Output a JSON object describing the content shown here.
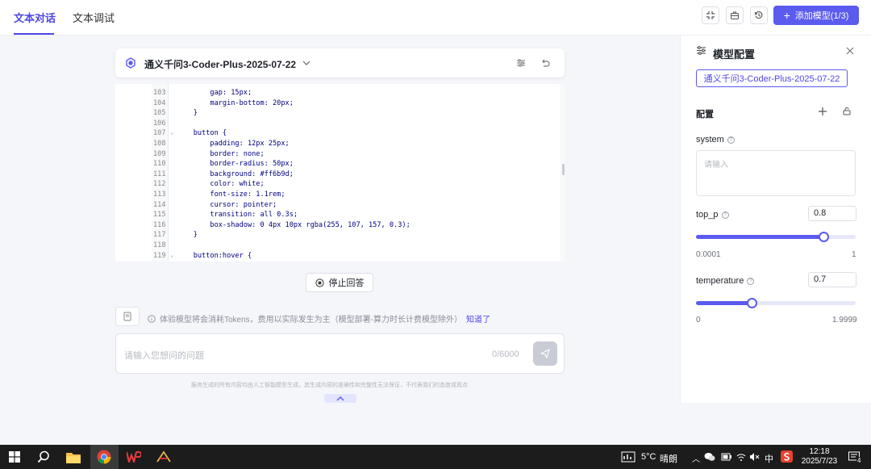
{
  "header": {
    "tabs": [
      {
        "label": "文本对话",
        "active": true
      },
      {
        "label": "文本调试",
        "active": false
      }
    ],
    "add_model_label": "添加模型(1/3)",
    "accent_color": "#5b5bf0"
  },
  "chat": {
    "model_name": "通义千问3-Coder-Plus-2025-07-22",
    "code_lines": [
      {
        "n": "103",
        "text": "        gap: 15px;",
        "fold": false
      },
      {
        "n": "104",
        "text": "        margin-bottom: 20px;",
        "fold": false
      },
      {
        "n": "105",
        "text": "    }",
        "fold": false
      },
      {
        "n": "106",
        "text": "",
        "fold": false
      },
      {
        "n": "107",
        "text": "    button {",
        "fold": true
      },
      {
        "n": "108",
        "text": "        padding: 12px 25px;",
        "fold": false
      },
      {
        "n": "109",
        "text": "        border: none;",
        "fold": false
      },
      {
        "n": "110",
        "text": "        border-radius: 50px;",
        "fold": false
      },
      {
        "n": "111",
        "text": "        background: #ff6b9d;",
        "fold": false
      },
      {
        "n": "112",
        "text": "        color: white;",
        "fold": false
      },
      {
        "n": "113",
        "text": "        font-size: 1.1rem;",
        "fold": false
      },
      {
        "n": "114",
        "text": "        cursor: pointer;",
        "fold": false
      },
      {
        "n": "115",
        "text": "        transition: all 0.3s;",
        "fold": false
      },
      {
        "n": "116",
        "text": "        box-shadow: 0 4px 10px rgba(255, 107, 157, 0.3);",
        "fold": false
      },
      {
        "n": "117",
        "text": "    }",
        "fold": false
      },
      {
        "n": "118",
        "text": "",
        "fold": false
      },
      {
        "n": "119",
        "text": "    button:hover {",
        "fold": true
      }
    ],
    "stop_label": "停止回答",
    "notice_text": "体验模型将会消耗Tokens，费用以实际发生为主（模型部署-算力时长计费模型除外）",
    "notice_link": "知道了",
    "input_placeholder": "请输入您想问的问题",
    "char_count": "0/6000",
    "disclaimer": "服务生成的所有内容均由人工智能模型生成，其生成内容的准确性和完整性无法保证，不代表我们的态度或观点"
  },
  "side_panel": {
    "title": "模型配置",
    "model_chip": "通义千问3-Coder-Plus-2025-07-22",
    "config_label": "配置",
    "system_label": "system",
    "system_placeholder": "请输入",
    "top_p": {
      "label": "top_p",
      "value": "0.8",
      "min": "0.0001",
      "max": "1",
      "fraction": 0.8
    },
    "temperature": {
      "label": "temperature",
      "value": "0.7",
      "min": "0",
      "max": "1.9999",
      "fraction": 0.35
    }
  },
  "taskbar": {
    "weather_temp": "5°C",
    "weather_text": "晴朗",
    "ime": "中",
    "time": "12:18",
    "date": "2025/7/23",
    "notification_count": "4"
  }
}
